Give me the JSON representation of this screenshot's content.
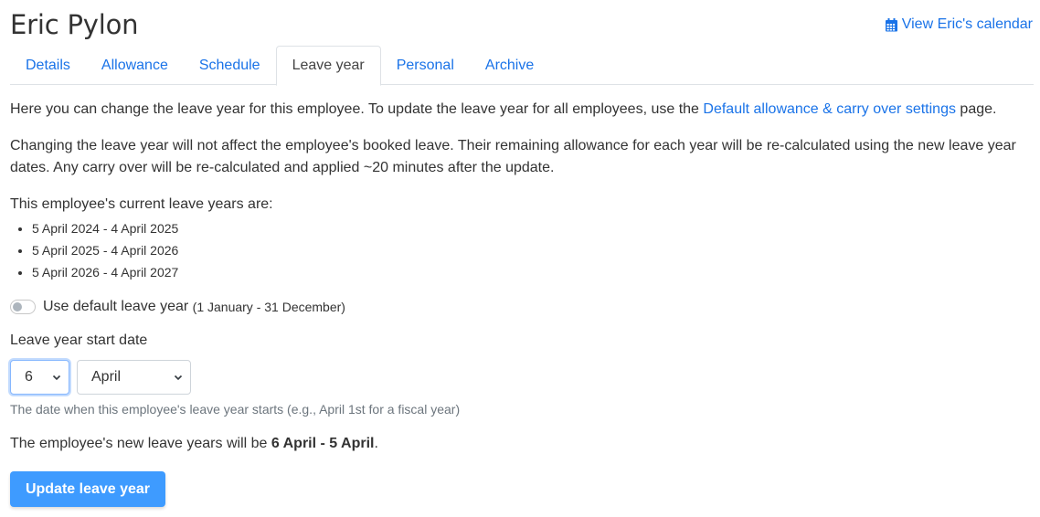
{
  "header": {
    "title": "Eric Pylon",
    "calendar_link": "View Eric's calendar"
  },
  "tabs": [
    {
      "label": "Details"
    },
    {
      "label": "Allowance"
    },
    {
      "label": "Schedule"
    },
    {
      "label": "Leave year",
      "active": true
    },
    {
      "label": "Personal"
    },
    {
      "label": "Archive"
    }
  ],
  "intro": {
    "before": "Here you can change the leave year for this employee. To update the leave year for all employees, use the ",
    "link": "Default allowance & carry over settings",
    "after": " page."
  },
  "notice": "Changing the leave year will not affect the employee's booked leave. Their remaining allowance for each year will be re-calculated using the new leave year dates. Any carry over will be re-calculated and applied ~20 minutes after the update.",
  "current_years": {
    "heading": "This employee's current leave years are:",
    "items": [
      "5 April 2024 - 4 April 2025",
      "5 April 2025 - 4 April 2026",
      "5 April 2026 - 4 April 2027"
    ]
  },
  "default_toggle": {
    "label": "Use default leave year",
    "range": "(1 January - 31 December)",
    "checked": false
  },
  "start_date": {
    "label": "Leave year start date",
    "day": "6",
    "month": "April",
    "help": "The date when this employee's leave year starts (e.g., April 1st for a fiscal year)"
  },
  "result": {
    "before": "The employee's new leave years will be ",
    "range": "6 April - 5 April",
    "after": "."
  },
  "submit_label": "Update leave year",
  "colors": {
    "link": "#1a73e8",
    "primary_button": "#3e9bff"
  }
}
